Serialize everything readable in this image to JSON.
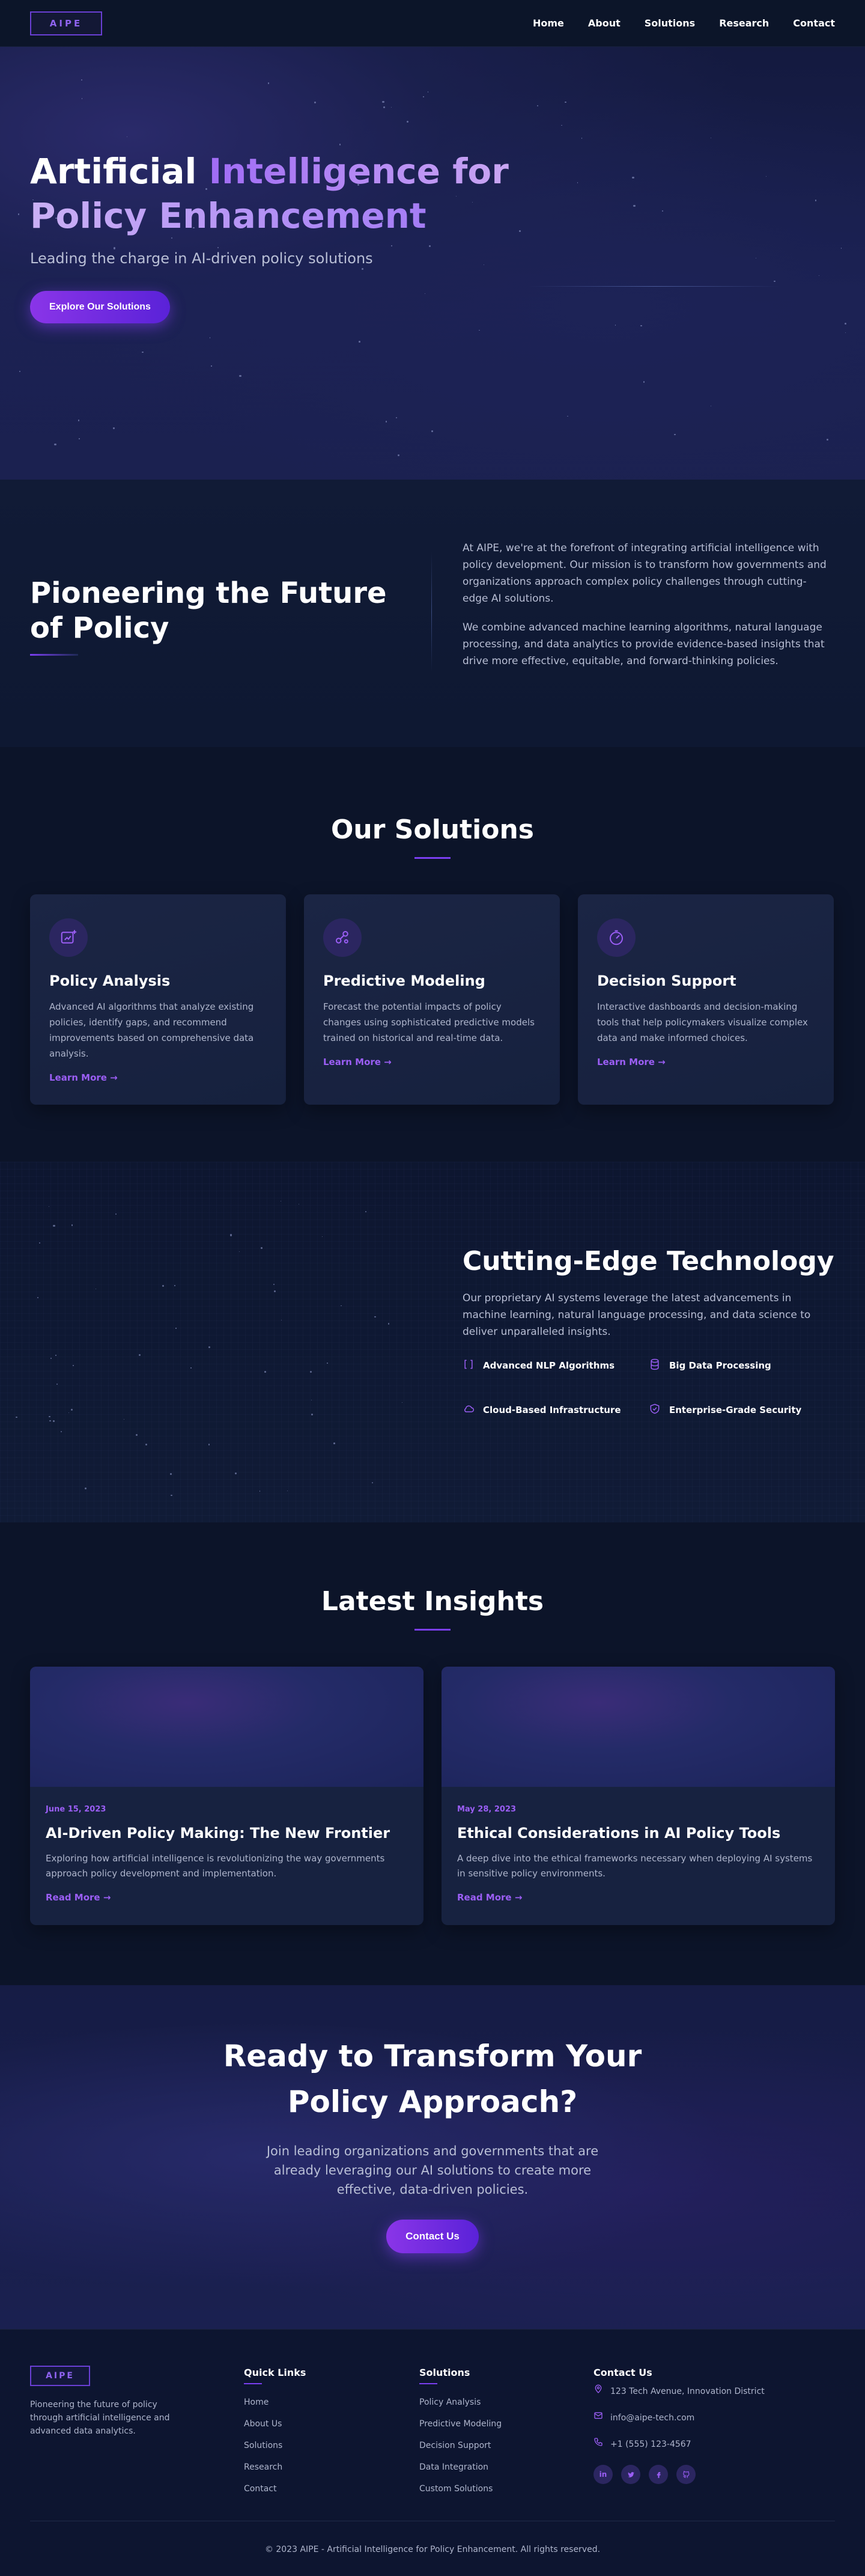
{
  "nav": {
    "logo": "AIPE",
    "links": [
      "Home",
      "About",
      "Solutions",
      "Research",
      "Contact"
    ]
  },
  "hero": {
    "title_line1_plain": "Artificial ",
    "title_line1_grad": "Intelligence for",
    "title_line2": "Policy Enhancement",
    "subtitle": "Leading the charge in AI-driven policy solutions",
    "cta": "Explore Our Solutions"
  },
  "about": {
    "title_line1": "Pioneering the Future",
    "title_line2": "of Policy",
    "paragraphs": [
      "At AIPE, we're at the forefront of integrating artificial intelligence with policy development. Our mission is to transform how governments and organizations approach complex policy challenges through cutting-edge AI solutions.",
      "We combine advanced machine learning algorithms, natural language processing, and data analytics to provide evidence-based insights that drive more effective, equitable, and forward-thinking policies."
    ]
  },
  "solutions": {
    "title": "Our Solutions",
    "cards": [
      {
        "icon": "chart-plus-icon",
        "title": "Policy Analysis",
        "text": "Advanced AI algorithms that analyze existing policies, identify gaps, and recommend improvements based on comprehensive data analysis.",
        "link": "Learn More →"
      },
      {
        "icon": "nodes-icon",
        "title": "Predictive Modeling",
        "text": "Forecast the potential impacts of policy changes using sophisticated predictive models trained on historical and real-time data.",
        "link": "Learn More →"
      },
      {
        "icon": "gauge-icon",
        "title": "Decision Support",
        "text": "Interactive dashboards and decision-making tools that help policymakers visualize complex data and make informed choices.",
        "link": "Learn More →"
      }
    ]
  },
  "technology": {
    "title": "Cutting-Edge Technology",
    "description": "Our proprietary AI systems leverage the latest advancements in machine learning, natural language processing, and data science to deliver unparalleled insights.",
    "features": [
      {
        "icon": "brackets-icon",
        "label": "Advanced NLP Algorithms"
      },
      {
        "icon": "database-icon",
        "label": "Big Data Processing"
      },
      {
        "icon": "cloud-icon",
        "label": "Cloud-Based Infrastructure"
      },
      {
        "icon": "shield-check-icon",
        "label": "Enterprise-Grade Security"
      }
    ]
  },
  "insights": {
    "title": "Latest Insights",
    "posts": [
      {
        "date": "June 15, 2023",
        "title": "AI-Driven Policy Making: The New Frontier",
        "text": "Exploring how artificial intelligence is revolutionizing the way governments approach policy development and implementation.",
        "link": "Read More →"
      },
      {
        "date": "May 28, 2023",
        "title": "Ethical Considerations in AI Policy Tools",
        "text": "A deep dive into the ethical frameworks necessary when deploying AI systems in sensitive policy environments.",
        "link": "Read More →"
      }
    ]
  },
  "cta": {
    "title": "Ready to Transform Your Policy Approach?",
    "text": "Join leading organizations and governments that are already leveraging our AI solutions to create more effective, data-driven policies.",
    "button": "Contact Us"
  },
  "footer": {
    "logo": "AIPE",
    "tagline": "Pioneering the future of policy through artificial intelligence and advanced data analytics.",
    "quick_links_title": "Quick Links",
    "quick_links": [
      "Home",
      "About Us",
      "Solutions",
      "Research",
      "Contact"
    ],
    "solutions_title": "Solutions",
    "solutions_links": [
      "Policy Analysis",
      "Predictive Modeling",
      "Decision Support",
      "Data Integration",
      "Custom Solutions"
    ],
    "contact_title": "Contact Us",
    "address": "123 Tech Avenue, Innovation District",
    "email": "info@aipe-tech.com",
    "phone": "+1 (555) 123-4567",
    "socials": [
      "in",
      "tw",
      "f",
      "gh"
    ],
    "copyright": "© 2023 AIPE - Artificial Intelligence for Policy Enhancement. All rights reserved."
  },
  "colors": {
    "accent": "#7a3ef0",
    "background": "#0b1428",
    "card": "#1b2544"
  }
}
